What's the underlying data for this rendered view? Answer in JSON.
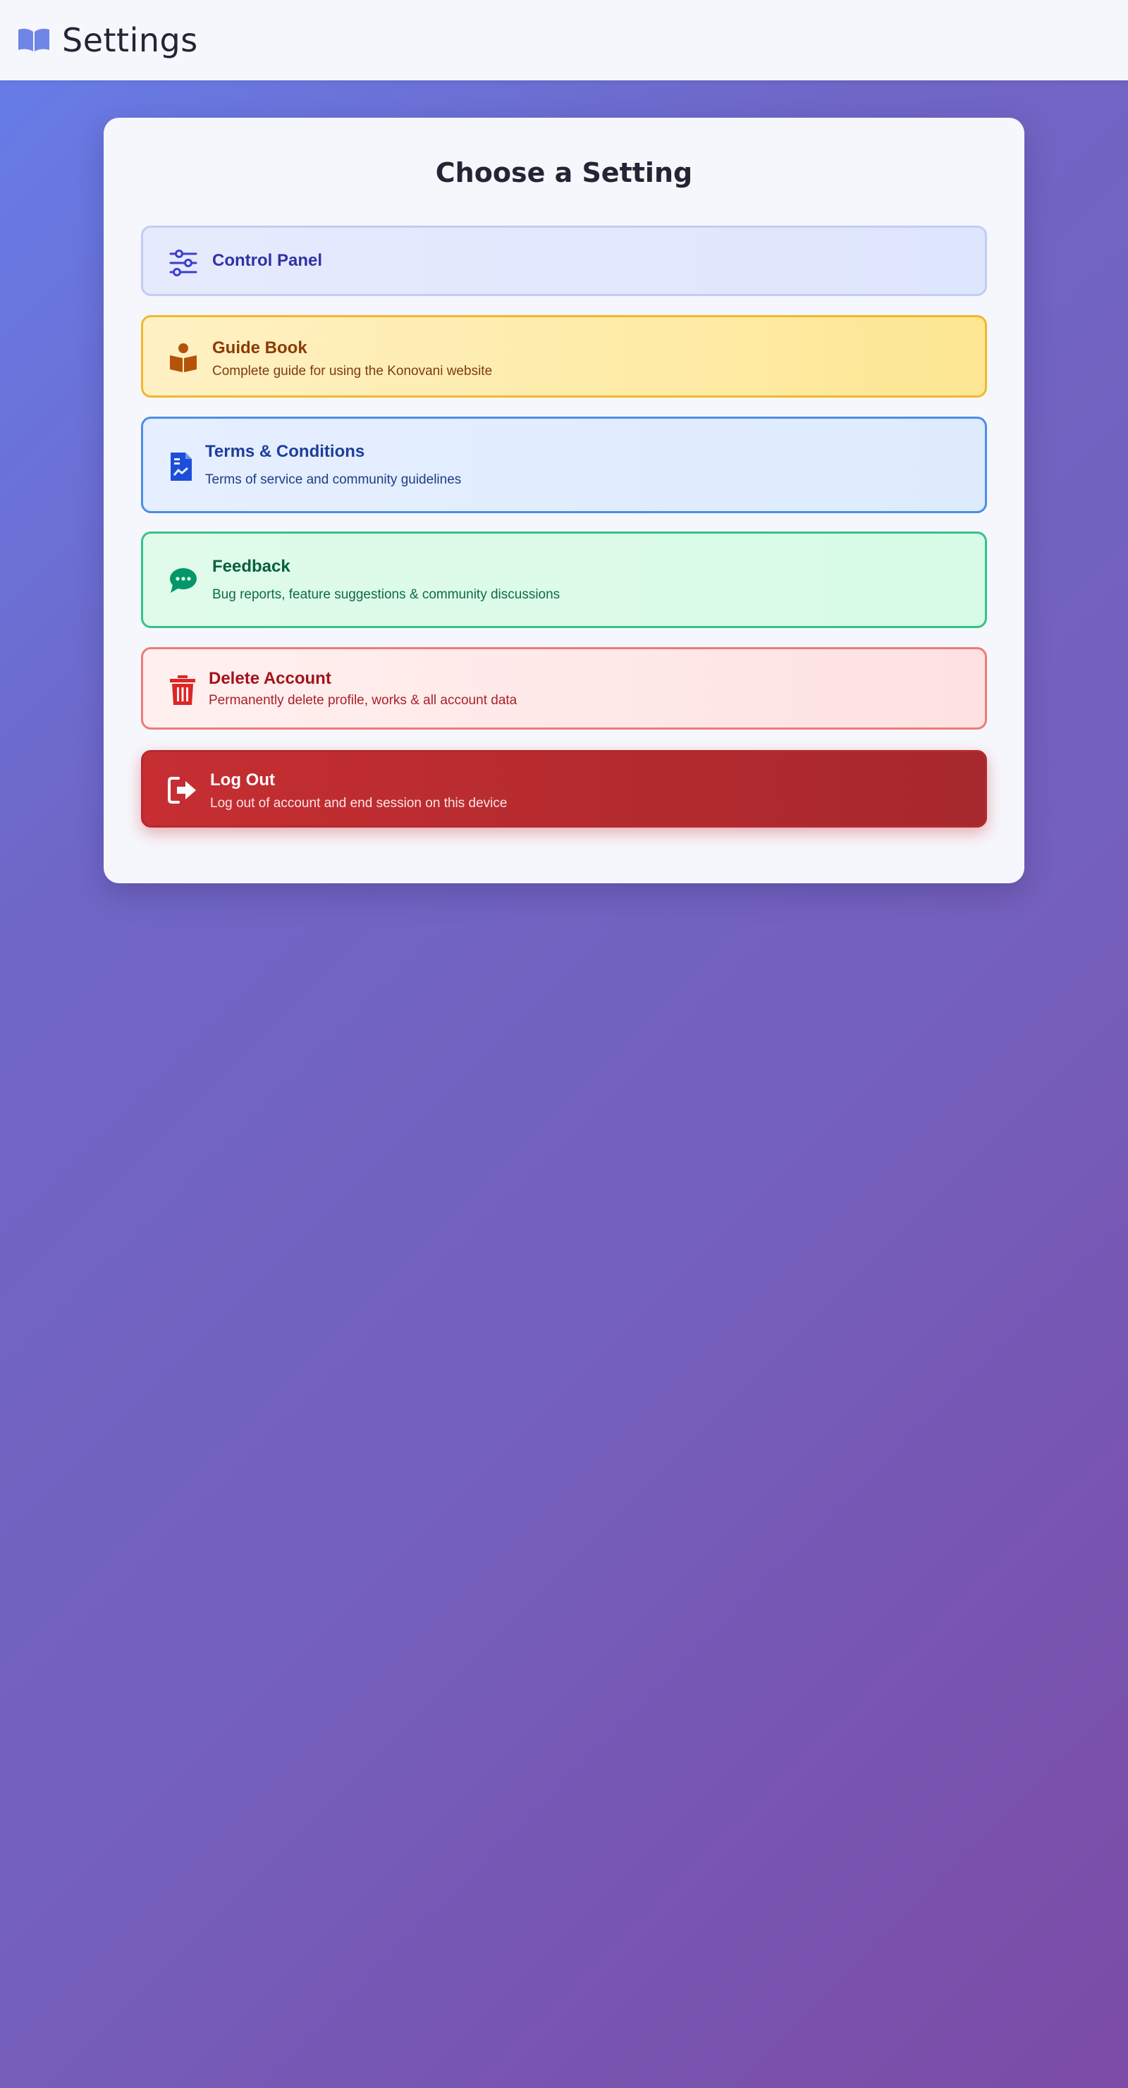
{
  "header": {
    "title": "Settings",
    "icon": "book-open-icon"
  },
  "card": {
    "heading": "Choose a Setting"
  },
  "options": [
    {
      "name": "Control Panel",
      "description": "",
      "icon": "sliders-icon",
      "color": "#2f33a6"
    },
    {
      "name": "Guide Book",
      "description": "Complete guide for using the Konovani website",
      "icon": "book-reader-icon",
      "color": "#8b3b06"
    },
    {
      "name": "Terms & Conditions",
      "description": "Terms of service and community guidelines",
      "icon": "document-icon",
      "color": "#1d3e9b"
    },
    {
      "name": "Feedback",
      "description": "Bug reports, feature suggestions & community discussions",
      "icon": "chat-bubble-icon",
      "color": "#075f3f"
    },
    {
      "name": "Delete Account",
      "description": "Permanently delete profile, works & all account data",
      "icon": "trash-icon",
      "color": "#a3121c"
    },
    {
      "name": "Log Out",
      "description": "Log out of account and end session on this device",
      "icon": "logout-icon",
      "color": "#ffffff"
    }
  ],
  "colors": {
    "accent": "#667eea",
    "header_background": "#f6f7fc"
  }
}
